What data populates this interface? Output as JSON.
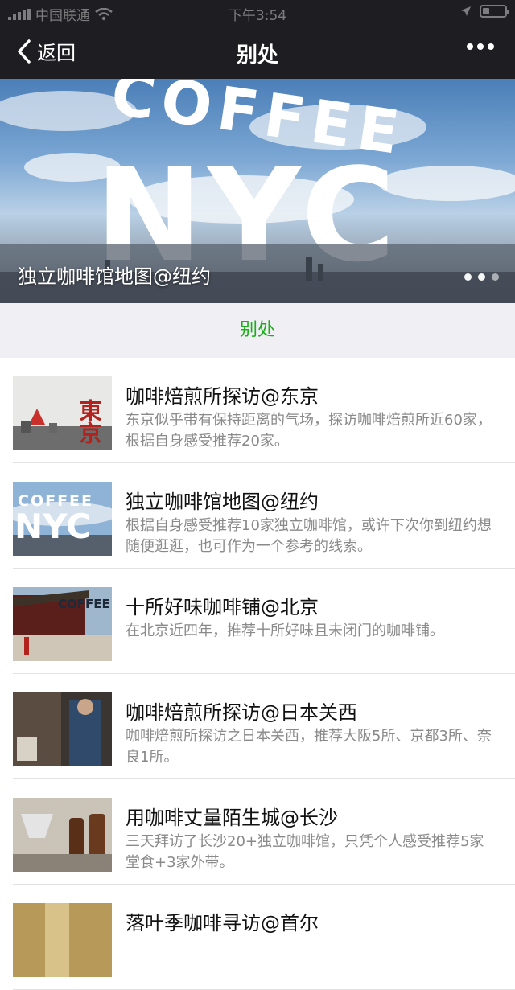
{
  "status_bar": {
    "carrier": "中国联通",
    "time": "下午3:54"
  },
  "nav": {
    "back_label": "返回",
    "title": "别处"
  },
  "banner": {
    "logo_line1": "COFFEE",
    "logo_line2": "NYC",
    "caption": "独立咖啡馆地图@纽约"
  },
  "section_title": "别处",
  "thumb_texts": {
    "tokyo": "東京",
    "nyc_line1": "COFFEE",
    "nyc_line2": "NYC",
    "beijing": "COFFEE"
  },
  "articles": [
    {
      "title": "咖啡焙煎所探访@东京",
      "desc": "东京似乎带有保持距离的气场，探访咖啡焙煎所近60家，根据自身感受推荐20家。"
    },
    {
      "title": "独立咖啡馆地图@纽约",
      "desc": "根据自身感受推荐10家独立咖啡馆，或许下次你到纽约想随便逛逛，也可作为一个参考的线索。"
    },
    {
      "title": "十所好味咖啡铺@北京",
      "desc": "在北京近四年，推荐十所好味且未闭门的咖啡铺。"
    },
    {
      "title": "咖啡焙煎所探访@日本关西",
      "desc": "咖啡焙煎所探访之日本关西，推荐大阪5所、京都3所、奈良1所。"
    },
    {
      "title": "用咖啡丈量陌生城@长沙",
      "desc": "三天拜访了长沙20+独立咖啡馆，只凭个人感受推荐5家堂食+3家外带。"
    },
    {
      "title": "落叶季咖啡寻访@首尔",
      "desc": ""
    }
  ],
  "colors": {
    "bar": "#1e1e22",
    "accent": "#1aad19",
    "section_bg": "#efeff4"
  }
}
